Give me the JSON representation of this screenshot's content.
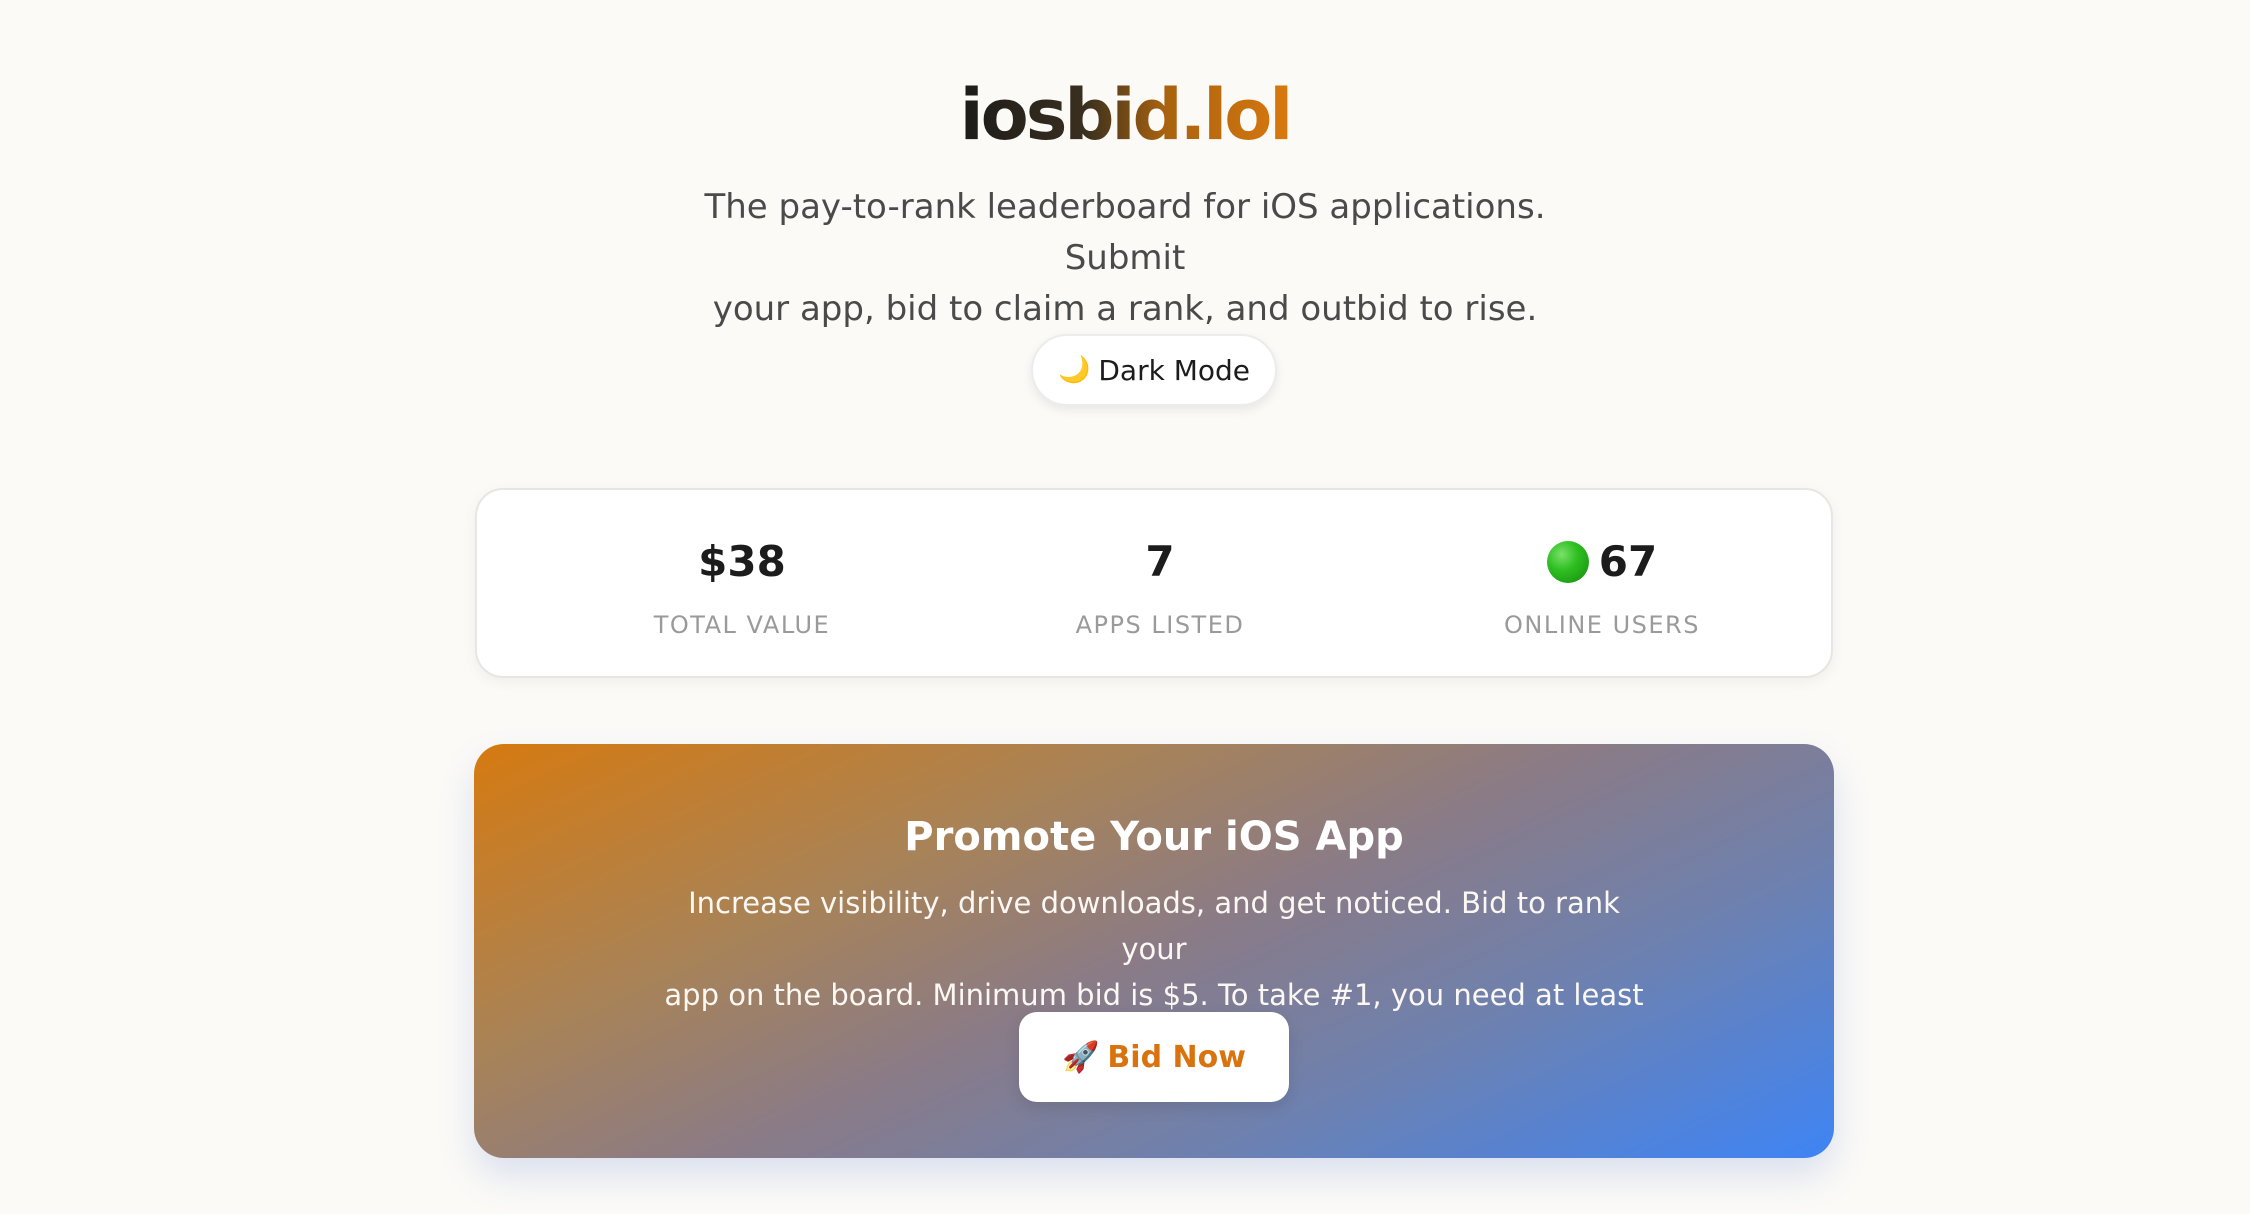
{
  "header": {
    "logo_text": "iosbid.lol",
    "tagline_line1": "The pay-to-rank leaderboard for iOS applications. Submit",
    "tagline_line2": "your app, bid to claim a rank, and outbid to rise."
  },
  "theme_toggle": {
    "icon": "moon-icon",
    "icon_glyph": "🌙",
    "label": "Dark Mode"
  },
  "stats": [
    {
      "value": "$38",
      "label": "TOTAL VALUE"
    },
    {
      "value": "7",
      "label": "APPS LISTED"
    },
    {
      "value": "67",
      "label": "ONLINE USERS",
      "icon": "green-circle-icon"
    }
  ],
  "promo": {
    "title": "Promote Your iOS App",
    "text_line1": "Increase visibility, drive downloads, and get noticed. Bid to rank your",
    "text_line2": "app on the board. Minimum bid is $5. To take #1, you need at least $12.",
    "button": {
      "icon": "rocket-icon",
      "icon_glyph": "🚀",
      "label": "Bid Now"
    }
  },
  "colors": {
    "accent_orange": "#d9730d",
    "accent_blue": "#3e84f5",
    "online_green": "#2fbf22"
  }
}
